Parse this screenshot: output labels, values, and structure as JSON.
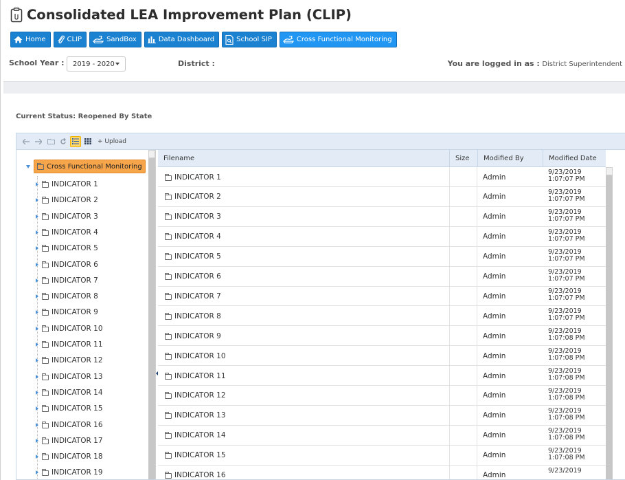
{
  "app": {
    "title": "Consolidated LEA Improvement Plan (CLIP)"
  },
  "nav": [
    {
      "label": "Home",
      "icon": "home-icon"
    },
    {
      "label": "CLIP",
      "icon": "paperclip-icon"
    },
    {
      "label": "SandBox",
      "icon": "sandbox-icon"
    },
    {
      "label": "Data Dashboard",
      "icon": "bar-chart-icon"
    },
    {
      "label": "School SIP",
      "icon": "document-search-icon"
    },
    {
      "label": "Cross Functional Monitoring",
      "icon": "sandbox-icon",
      "active": true
    }
  ],
  "filters": {
    "school_year_label": "School Year :",
    "school_year_value": "2019 - 2020",
    "district_label": "District :",
    "logged_in_label": "You are logged in as :",
    "logged_in_value": "District Superintendent"
  },
  "status": {
    "label": "Current Status:",
    "value": "Reopened By State"
  },
  "toolbar": {
    "upload_label": "+ Upload"
  },
  "tree": {
    "root": "Cross Functional Monitoring",
    "items": [
      "INDICATOR 1",
      "INDICATOR 2",
      "INDICATOR 3",
      "INDICATOR 4",
      "INDICATOR 5",
      "INDICATOR 6",
      "INDICATOR 7",
      "INDICATOR 8",
      "INDICATOR 9",
      "INDICATOR 10",
      "INDICATOR 11",
      "INDICATOR 12",
      "INDICATOR 13",
      "INDICATOR 14",
      "INDICATOR 15",
      "INDICATOR 16",
      "INDICATOR 17",
      "INDICATOR 18",
      "INDICATOR 19"
    ]
  },
  "grid": {
    "columns": [
      "Filename",
      "Size",
      "Modified By",
      "Modified Date"
    ],
    "rows": [
      {
        "name": "INDICATOR 1",
        "size": "",
        "by": "Admin",
        "date1": "9/23/2019",
        "date2": "1:07:07 PM"
      },
      {
        "name": "INDICATOR 2",
        "size": "",
        "by": "Admin",
        "date1": "9/23/2019",
        "date2": "1:07:07 PM"
      },
      {
        "name": "INDICATOR 3",
        "size": "",
        "by": "Admin",
        "date1": "9/23/2019",
        "date2": "1:07:07 PM"
      },
      {
        "name": "INDICATOR 4",
        "size": "",
        "by": "Admin",
        "date1": "9/23/2019",
        "date2": "1:07:07 PM"
      },
      {
        "name": "INDICATOR 5",
        "size": "",
        "by": "Admin",
        "date1": "9/23/2019",
        "date2": "1:07:07 PM"
      },
      {
        "name": "INDICATOR 6",
        "size": "",
        "by": "Admin",
        "date1": "9/23/2019",
        "date2": "1:07:07 PM"
      },
      {
        "name": "INDICATOR 7",
        "size": "",
        "by": "Admin",
        "date1": "9/23/2019",
        "date2": "1:07:07 PM"
      },
      {
        "name": "INDICATOR 8",
        "size": "",
        "by": "Admin",
        "date1": "9/23/2019",
        "date2": "1:07:07 PM"
      },
      {
        "name": "INDICATOR 9",
        "size": "",
        "by": "Admin",
        "date1": "9/23/2019",
        "date2": "1:07:08 PM"
      },
      {
        "name": "INDICATOR 10",
        "size": "",
        "by": "Admin",
        "date1": "9/23/2019",
        "date2": "1:07:08 PM"
      },
      {
        "name": "INDICATOR 11",
        "size": "",
        "by": "Admin",
        "date1": "9/23/2019",
        "date2": "1:07:08 PM"
      },
      {
        "name": "INDICATOR 12",
        "size": "",
        "by": "Admin",
        "date1": "9/23/2019",
        "date2": "1:07:08 PM"
      },
      {
        "name": "INDICATOR 13",
        "size": "",
        "by": "Admin",
        "date1": "9/23/2019",
        "date2": "1:07:08 PM"
      },
      {
        "name": "INDICATOR 14",
        "size": "",
        "by": "Admin",
        "date1": "9/23/2019",
        "date2": "1:07:08 PM"
      },
      {
        "name": "INDICATOR 15",
        "size": "",
        "by": "Admin",
        "date1": "9/23/2019",
        "date2": "1:07:08 PM"
      },
      {
        "name": "INDICATOR 16",
        "size": "",
        "by": "Admin",
        "date1": "9/23/2019",
        "date2": ""
      }
    ]
  },
  "colors": {
    "nav_blue": "#1a82d0",
    "tree_highlight": "#f7a54a",
    "header_bg": "#e3ecf6"
  }
}
